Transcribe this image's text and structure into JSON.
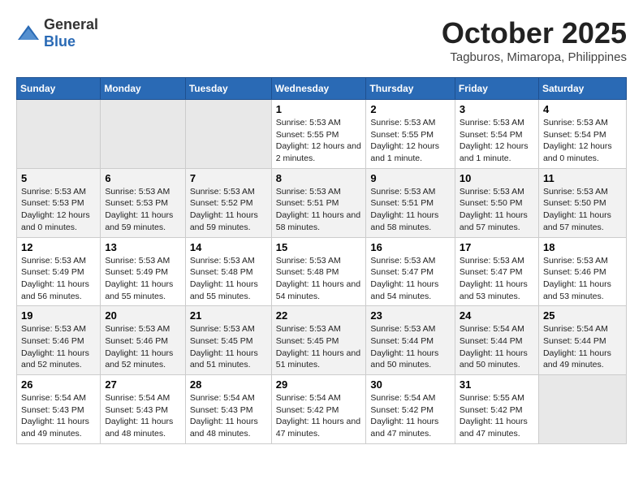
{
  "logo": {
    "general": "General",
    "blue": "Blue"
  },
  "title": "October 2025",
  "subtitle": "Tagburos, Mimaropa, Philippines",
  "headers": [
    "Sunday",
    "Monday",
    "Tuesday",
    "Wednesday",
    "Thursday",
    "Friday",
    "Saturday"
  ],
  "weeks": [
    [
      {
        "day": "",
        "empty": true
      },
      {
        "day": "",
        "empty": true
      },
      {
        "day": "",
        "empty": true
      },
      {
        "day": "1",
        "sunrise": "5:53 AM",
        "sunset": "5:55 PM",
        "daylight": "12 hours and 2 minutes."
      },
      {
        "day": "2",
        "sunrise": "5:53 AM",
        "sunset": "5:55 PM",
        "daylight": "12 hours and 1 minute."
      },
      {
        "day": "3",
        "sunrise": "5:53 AM",
        "sunset": "5:54 PM",
        "daylight": "12 hours and 1 minute."
      },
      {
        "day": "4",
        "sunrise": "5:53 AM",
        "sunset": "5:54 PM",
        "daylight": "12 hours and 0 minutes."
      }
    ],
    [
      {
        "day": "5",
        "sunrise": "5:53 AM",
        "sunset": "5:53 PM",
        "daylight": "12 hours and 0 minutes."
      },
      {
        "day": "6",
        "sunrise": "5:53 AM",
        "sunset": "5:53 PM",
        "daylight": "11 hours and 59 minutes."
      },
      {
        "day": "7",
        "sunrise": "5:53 AM",
        "sunset": "5:52 PM",
        "daylight": "11 hours and 59 minutes."
      },
      {
        "day": "8",
        "sunrise": "5:53 AM",
        "sunset": "5:51 PM",
        "daylight": "11 hours and 58 minutes."
      },
      {
        "day": "9",
        "sunrise": "5:53 AM",
        "sunset": "5:51 PM",
        "daylight": "11 hours and 58 minutes."
      },
      {
        "day": "10",
        "sunrise": "5:53 AM",
        "sunset": "5:50 PM",
        "daylight": "11 hours and 57 minutes."
      },
      {
        "day": "11",
        "sunrise": "5:53 AM",
        "sunset": "5:50 PM",
        "daylight": "11 hours and 57 minutes."
      }
    ],
    [
      {
        "day": "12",
        "sunrise": "5:53 AM",
        "sunset": "5:49 PM",
        "daylight": "11 hours and 56 minutes."
      },
      {
        "day": "13",
        "sunrise": "5:53 AM",
        "sunset": "5:49 PM",
        "daylight": "11 hours and 55 minutes."
      },
      {
        "day": "14",
        "sunrise": "5:53 AM",
        "sunset": "5:48 PM",
        "daylight": "11 hours and 55 minutes."
      },
      {
        "day": "15",
        "sunrise": "5:53 AM",
        "sunset": "5:48 PM",
        "daylight": "11 hours and 54 minutes."
      },
      {
        "day": "16",
        "sunrise": "5:53 AM",
        "sunset": "5:47 PM",
        "daylight": "11 hours and 54 minutes."
      },
      {
        "day": "17",
        "sunrise": "5:53 AM",
        "sunset": "5:47 PM",
        "daylight": "11 hours and 53 minutes."
      },
      {
        "day": "18",
        "sunrise": "5:53 AM",
        "sunset": "5:46 PM",
        "daylight": "11 hours and 53 minutes."
      }
    ],
    [
      {
        "day": "19",
        "sunrise": "5:53 AM",
        "sunset": "5:46 PM",
        "daylight": "11 hours and 52 minutes."
      },
      {
        "day": "20",
        "sunrise": "5:53 AM",
        "sunset": "5:46 PM",
        "daylight": "11 hours and 52 minutes."
      },
      {
        "day": "21",
        "sunrise": "5:53 AM",
        "sunset": "5:45 PM",
        "daylight": "11 hours and 51 minutes."
      },
      {
        "day": "22",
        "sunrise": "5:53 AM",
        "sunset": "5:45 PM",
        "daylight": "11 hours and 51 minutes."
      },
      {
        "day": "23",
        "sunrise": "5:53 AM",
        "sunset": "5:44 PM",
        "daylight": "11 hours and 50 minutes."
      },
      {
        "day": "24",
        "sunrise": "5:54 AM",
        "sunset": "5:44 PM",
        "daylight": "11 hours and 50 minutes."
      },
      {
        "day": "25",
        "sunrise": "5:54 AM",
        "sunset": "5:44 PM",
        "daylight": "11 hours and 49 minutes."
      }
    ],
    [
      {
        "day": "26",
        "sunrise": "5:54 AM",
        "sunset": "5:43 PM",
        "daylight": "11 hours and 49 minutes."
      },
      {
        "day": "27",
        "sunrise": "5:54 AM",
        "sunset": "5:43 PM",
        "daylight": "11 hours and 48 minutes."
      },
      {
        "day": "28",
        "sunrise": "5:54 AM",
        "sunset": "5:43 PM",
        "daylight": "11 hours and 48 minutes."
      },
      {
        "day": "29",
        "sunrise": "5:54 AM",
        "sunset": "5:42 PM",
        "daylight": "11 hours and 47 minutes."
      },
      {
        "day": "30",
        "sunrise": "5:54 AM",
        "sunset": "5:42 PM",
        "daylight": "11 hours and 47 minutes."
      },
      {
        "day": "31",
        "sunrise": "5:55 AM",
        "sunset": "5:42 PM",
        "daylight": "11 hours and 47 minutes."
      },
      {
        "day": "",
        "empty": true
      }
    ]
  ]
}
